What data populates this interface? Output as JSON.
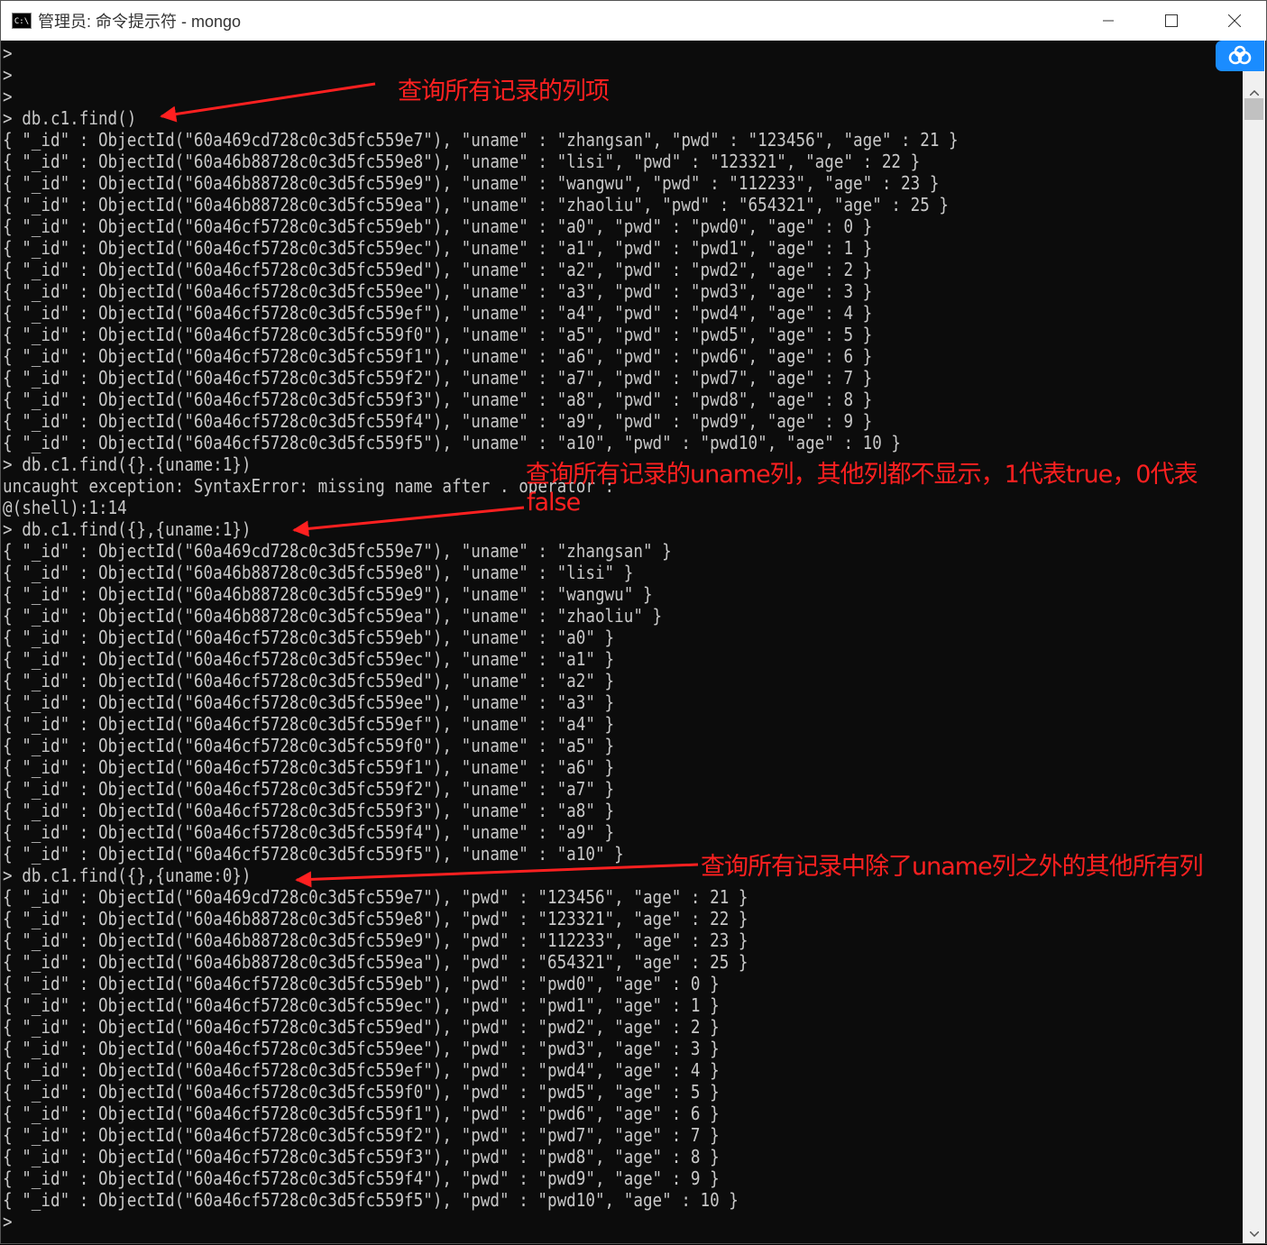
{
  "window": {
    "title": "管理员: 命令提示符 - mongo",
    "app_icon_text": "C:\\"
  },
  "console_lines": [
    "> ",
    "> ",
    "> ",
    "> db.c1.find()",
    "{ \"_id\" : ObjectId(\"60a469cd728c0c3d5fc559e7\"), \"uname\" : \"zhangsan\", \"pwd\" : \"123456\", \"age\" : 21 }",
    "{ \"_id\" : ObjectId(\"60a46b88728c0c3d5fc559e8\"), \"uname\" : \"lisi\", \"pwd\" : \"123321\", \"age\" : 22 }",
    "{ \"_id\" : ObjectId(\"60a46b88728c0c3d5fc559e9\"), \"uname\" : \"wangwu\", \"pwd\" : \"112233\", \"age\" : 23 }",
    "{ \"_id\" : ObjectId(\"60a46b88728c0c3d5fc559ea\"), \"uname\" : \"zhaoliu\", \"pwd\" : \"654321\", \"age\" : 25 }",
    "{ \"_id\" : ObjectId(\"60a46cf5728c0c3d5fc559eb\"), \"uname\" : \"a0\", \"pwd\" : \"pwd0\", \"age\" : 0 }",
    "{ \"_id\" : ObjectId(\"60a46cf5728c0c3d5fc559ec\"), \"uname\" : \"a1\", \"pwd\" : \"pwd1\", \"age\" : 1 }",
    "{ \"_id\" : ObjectId(\"60a46cf5728c0c3d5fc559ed\"), \"uname\" : \"a2\", \"pwd\" : \"pwd2\", \"age\" : 2 }",
    "{ \"_id\" : ObjectId(\"60a46cf5728c0c3d5fc559ee\"), \"uname\" : \"a3\", \"pwd\" : \"pwd3\", \"age\" : 3 }",
    "{ \"_id\" : ObjectId(\"60a46cf5728c0c3d5fc559ef\"), \"uname\" : \"a4\", \"pwd\" : \"pwd4\", \"age\" : 4 }",
    "{ \"_id\" : ObjectId(\"60a46cf5728c0c3d5fc559f0\"), \"uname\" : \"a5\", \"pwd\" : \"pwd5\", \"age\" : 5 }",
    "{ \"_id\" : ObjectId(\"60a46cf5728c0c3d5fc559f1\"), \"uname\" : \"a6\", \"pwd\" : \"pwd6\", \"age\" : 6 }",
    "{ \"_id\" : ObjectId(\"60a46cf5728c0c3d5fc559f2\"), \"uname\" : \"a7\", \"pwd\" : \"pwd7\", \"age\" : 7 }",
    "{ \"_id\" : ObjectId(\"60a46cf5728c0c3d5fc559f3\"), \"uname\" : \"a8\", \"pwd\" : \"pwd8\", \"age\" : 8 }",
    "{ \"_id\" : ObjectId(\"60a46cf5728c0c3d5fc559f4\"), \"uname\" : \"a9\", \"pwd\" : \"pwd9\", \"age\" : 9 }",
    "{ \"_id\" : ObjectId(\"60a46cf5728c0c3d5fc559f5\"), \"uname\" : \"a10\", \"pwd\" : \"pwd10\", \"age\" : 10 }",
    "> db.c1.find({}.{uname:1})",
    "uncaught exception: SyntaxError: missing name after . operator :",
    "@(shell):1:14",
    "> db.c1.find({},{uname:1})",
    "{ \"_id\" : ObjectId(\"60a469cd728c0c3d5fc559e7\"), \"uname\" : \"zhangsan\" }",
    "{ \"_id\" : ObjectId(\"60a46b88728c0c3d5fc559e8\"), \"uname\" : \"lisi\" }",
    "{ \"_id\" : ObjectId(\"60a46b88728c0c3d5fc559e9\"), \"uname\" : \"wangwu\" }",
    "{ \"_id\" : ObjectId(\"60a46b88728c0c3d5fc559ea\"), \"uname\" : \"zhaoliu\" }",
    "{ \"_id\" : ObjectId(\"60a46cf5728c0c3d5fc559eb\"), \"uname\" : \"a0\" }",
    "{ \"_id\" : ObjectId(\"60a46cf5728c0c3d5fc559ec\"), \"uname\" : \"a1\" }",
    "{ \"_id\" : ObjectId(\"60a46cf5728c0c3d5fc559ed\"), \"uname\" : \"a2\" }",
    "{ \"_id\" : ObjectId(\"60a46cf5728c0c3d5fc559ee\"), \"uname\" : \"a3\" }",
    "{ \"_id\" : ObjectId(\"60a46cf5728c0c3d5fc559ef\"), \"uname\" : \"a4\" }",
    "{ \"_id\" : ObjectId(\"60a46cf5728c0c3d5fc559f0\"), \"uname\" : \"a5\" }",
    "{ \"_id\" : ObjectId(\"60a46cf5728c0c3d5fc559f1\"), \"uname\" : \"a6\" }",
    "{ \"_id\" : ObjectId(\"60a46cf5728c0c3d5fc559f2\"), \"uname\" : \"a7\" }",
    "{ \"_id\" : ObjectId(\"60a46cf5728c0c3d5fc559f3\"), \"uname\" : \"a8\" }",
    "{ \"_id\" : ObjectId(\"60a46cf5728c0c3d5fc559f4\"), \"uname\" : \"a9\" }",
    "{ \"_id\" : ObjectId(\"60a46cf5728c0c3d5fc559f5\"), \"uname\" : \"a10\" }",
    "> db.c1.find({},{uname:0})",
    "{ \"_id\" : ObjectId(\"60a469cd728c0c3d5fc559e7\"), \"pwd\" : \"123456\", \"age\" : 21 }",
    "{ \"_id\" : ObjectId(\"60a46b88728c0c3d5fc559e8\"), \"pwd\" : \"123321\", \"age\" : 22 }",
    "{ \"_id\" : ObjectId(\"60a46b88728c0c3d5fc559e9\"), \"pwd\" : \"112233\", \"age\" : 23 }",
    "{ \"_id\" : ObjectId(\"60a46b88728c0c3d5fc559ea\"), \"pwd\" : \"654321\", \"age\" : 25 }",
    "{ \"_id\" : ObjectId(\"60a46cf5728c0c3d5fc559eb\"), \"pwd\" : \"pwd0\", \"age\" : 0 }",
    "{ \"_id\" : ObjectId(\"60a46cf5728c0c3d5fc559ec\"), \"pwd\" : \"pwd1\", \"age\" : 1 }",
    "{ \"_id\" : ObjectId(\"60a46cf5728c0c3d5fc559ed\"), \"pwd\" : \"pwd2\", \"age\" : 2 }",
    "{ \"_id\" : ObjectId(\"60a46cf5728c0c3d5fc559ee\"), \"pwd\" : \"pwd3\", \"age\" : 3 }",
    "{ \"_id\" : ObjectId(\"60a46cf5728c0c3d5fc559ef\"), \"pwd\" : \"pwd4\", \"age\" : 4 }",
    "{ \"_id\" : ObjectId(\"60a46cf5728c0c3d5fc559f0\"), \"pwd\" : \"pwd5\", \"age\" : 5 }",
    "{ \"_id\" : ObjectId(\"60a46cf5728c0c3d5fc559f1\"), \"pwd\" : \"pwd6\", \"age\" : 6 }",
    "{ \"_id\" : ObjectId(\"60a46cf5728c0c3d5fc559f2\"), \"pwd\" : \"pwd7\", \"age\" : 7 }",
    "{ \"_id\" : ObjectId(\"60a46cf5728c0c3d5fc559f3\"), \"pwd\" : \"pwd8\", \"age\" : 8 }",
    "{ \"_id\" : ObjectId(\"60a46cf5728c0c3d5fc559f4\"), \"pwd\" : \"pwd9\", \"age\" : 9 }",
    "{ \"_id\" : ObjectId(\"60a46cf5728c0c3d5fc559f5\"), \"pwd\" : \"pwd10\", \"age\" : 10 }",
    "> "
  ],
  "annotations": {
    "note1": "查询所有记录的列项",
    "note2a": "查询所有记录的uname列，其他列都不显示，1代表true，0代表",
    "note2b": "false",
    "note3": "查询所有记录中除了uname列之外的其他所有列"
  },
  "colors": {
    "console_bg": "#0c0c0c",
    "console_text": "#c8c8c8",
    "annotation": "#ff2020",
    "cloud_badge": "#1a8cff"
  },
  "icons": {
    "app": "cmd-icon",
    "minimize": "minimize-icon",
    "maximize": "maximize-icon",
    "close": "close-icon",
    "cloud": "baidu-cloud-icon"
  }
}
